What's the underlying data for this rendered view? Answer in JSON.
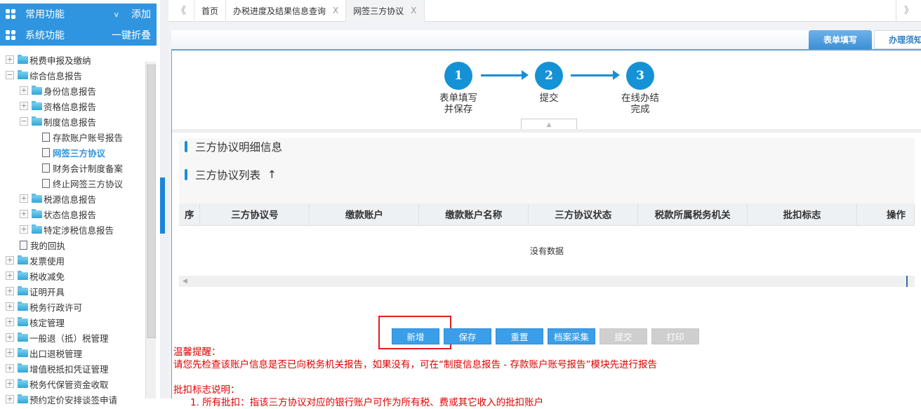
{
  "sidebar": {
    "common": {
      "label": "常用功能",
      "toggle": "v",
      "action": "添加"
    },
    "system": {
      "label": "系统功能",
      "action": "一键折叠"
    },
    "tree": [
      {
        "label": "税费申报及缴纳",
        "level": 0,
        "type": "folder",
        "state": "+"
      },
      {
        "label": "综合信息报告",
        "level": 0,
        "type": "folder",
        "state": "-"
      },
      {
        "label": "身份信息报告",
        "level": 1,
        "type": "folder",
        "state": "+"
      },
      {
        "label": "资格信息报告",
        "level": 1,
        "type": "folder",
        "state": "+"
      },
      {
        "label": "制度信息报告",
        "level": 1,
        "type": "folder",
        "state": "-"
      },
      {
        "label": "存款账户账号报告",
        "level": 2,
        "type": "file"
      },
      {
        "label": "网签三方协议",
        "level": 2,
        "type": "file",
        "active": true
      },
      {
        "label": "财务会计制度备案",
        "level": 2,
        "type": "file"
      },
      {
        "label": "终止网签三方协议",
        "level": 2,
        "type": "file"
      },
      {
        "label": "税源信息报告",
        "level": 1,
        "type": "folder",
        "state": "+"
      },
      {
        "label": "状态信息报告",
        "level": 1,
        "type": "folder",
        "state": "+"
      },
      {
        "label": "特定涉税信息报告",
        "level": 1,
        "type": "folder",
        "state": "+"
      },
      {
        "label": "我的回执",
        "level": 1,
        "type": "file",
        "nobox": true
      },
      {
        "label": "发票使用",
        "level": 0,
        "type": "folder",
        "state": "+"
      },
      {
        "label": "税收减免",
        "level": 0,
        "type": "folder",
        "state": "+"
      },
      {
        "label": "证明开具",
        "level": 0,
        "type": "folder",
        "state": "+"
      },
      {
        "label": "税务行政许可",
        "level": 0,
        "type": "folder",
        "state": "+"
      },
      {
        "label": "核定管理",
        "level": 0,
        "type": "folder",
        "state": "+"
      },
      {
        "label": "一般退（抵）税管理",
        "level": 0,
        "type": "folder",
        "state": "+"
      },
      {
        "label": "出口退税管理",
        "level": 0,
        "type": "folder",
        "state": "+"
      },
      {
        "label": "增值税抵扣凭证管理",
        "level": 0,
        "type": "folder",
        "state": "+"
      },
      {
        "label": "税务代保管资金收取",
        "level": 0,
        "type": "folder",
        "state": "+"
      },
      {
        "label": "预约定价安排谈签申请",
        "level": 0,
        "type": "folder",
        "state": "+"
      }
    ]
  },
  "tabs": {
    "prev": "《",
    "next": "》",
    "items": [
      {
        "label": "首页"
      },
      {
        "label": "办税进度及结果信息查询",
        "close": "X"
      },
      {
        "label": "网签三方协议",
        "close": "X",
        "active": true
      }
    ]
  },
  "right_tabs": [
    {
      "label": "表单填写",
      "active": true
    },
    {
      "label": "办理须知"
    }
  ],
  "steps": [
    {
      "num": "1",
      "label1": "表单填写",
      "label2": "并保存"
    },
    {
      "num": "2",
      "label1": "提交",
      "label2": ""
    },
    {
      "num": "3",
      "label1": "在线办结",
      "label2": "完成"
    }
  ],
  "section1": "三方协议明细信息",
  "section2": "三方协议列表",
  "section2_arrow": "↑",
  "table": {
    "headers": [
      "序",
      "三方协议号",
      "缴款账户",
      "缴款账户名称",
      "三方协议状态",
      "税款所属税务机关",
      "批扣标志",
      "操作"
    ],
    "empty": "没有数据"
  },
  "buttons": [
    {
      "label": "新增",
      "enabled": true
    },
    {
      "label": "保存",
      "enabled": true
    },
    {
      "label": "重置",
      "enabled": true
    },
    {
      "label": "档案采集",
      "enabled": true
    },
    {
      "label": "提交",
      "enabled": false
    },
    {
      "label": "打印",
      "enabled": false
    }
  ],
  "tips": {
    "title": "温馨提醒：",
    "line1": "请您先检查该账户信息是否已向税务机关报告，如果没有，可在“制度信息报告 - 存款账户账号报告”模块先进行报告",
    "title2": "批扣标志说明：",
    "line2": "1. 所有批扣：指该三方协议对应的银行账户可作为所有税、费或其它收入的批扣账户"
  }
}
